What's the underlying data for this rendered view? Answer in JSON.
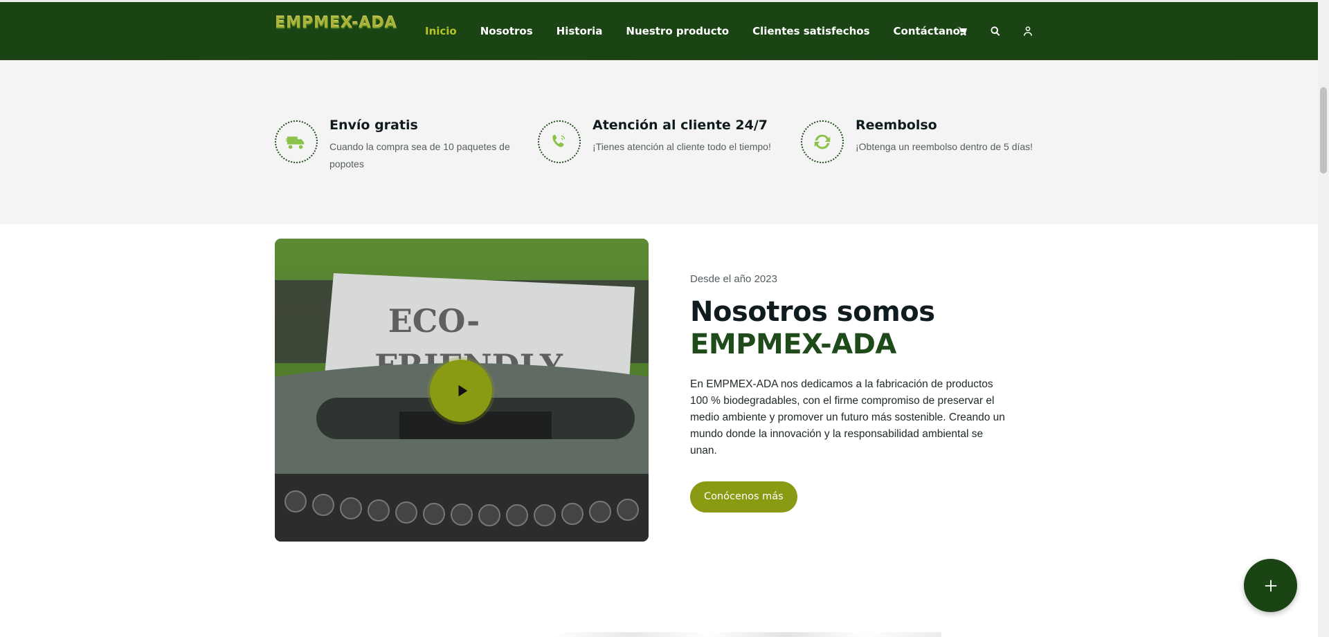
{
  "header": {
    "logo_text": "EMPMEX-ADA",
    "menu": [
      {
        "label": "Inicio",
        "active": true
      },
      {
        "label": "Nosotros",
        "active": false
      },
      {
        "label": "Historia",
        "active": false
      },
      {
        "label": "Nuestro producto",
        "active": false
      },
      {
        "label": "Clientes satisfechos",
        "active": false
      },
      {
        "label": "Contáctanos",
        "active": false
      }
    ],
    "icons": [
      "cart-icon",
      "search-icon",
      "user-icon"
    ]
  },
  "features": [
    {
      "icon": "truck-icon",
      "title": "Envío gratis",
      "description": "Cuando la compra sea de 10 paquetes de popotes"
    },
    {
      "icon": "phone-icon",
      "title": "Atención al cliente 24/7",
      "description": "¡Tienes atención al cliente todo el tiempo!"
    },
    {
      "icon": "refresh-icon",
      "title": "Reembolso",
      "description": "¡Obtenga un reembolso dentro de 5 días!"
    }
  ],
  "about": {
    "image_text_line1": "ECO-",
    "image_text_line2": "FRIENDLY",
    "eyebrow": "Desde el año 2023",
    "heading_line1": "Nosotros somos",
    "heading_line2": "EMPMEX-ADA",
    "body": "En EMPMEX-ADA nos dedicamos a la fabricación de productos 100 % biodegradables, con el firme compromiso de preservar el medio ambiente y promover un futuro más sostenible. Creando un mundo donde la innovación y la responsabilidad ambiental se unan.",
    "cta_label": "Conócenos más"
  },
  "colors": {
    "nav_bg": "#1a4413",
    "accent_olive": "#8a9a12",
    "active_menu": "#b8c22d",
    "brand_green": "#1f4a19",
    "feature_icon": "#8bc34a"
  }
}
